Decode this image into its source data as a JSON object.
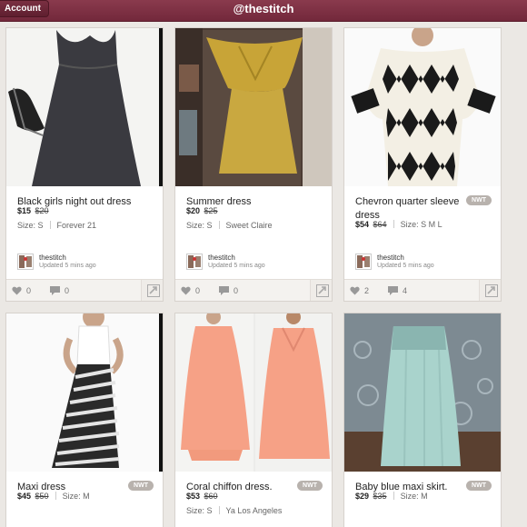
{
  "topbar": {
    "account_label": "Account",
    "title": "@thestitch"
  },
  "listings": [
    {
      "title": "Black girls night out dress",
      "price": "$15",
      "original_price": "$20",
      "size": "Size: S",
      "brand": "Forever 21",
      "nwt": "",
      "seller": "thestitch",
      "updated": "Updated 5 mins ago",
      "likes": "0",
      "comments": "0"
    },
    {
      "title": "Summer dress",
      "price": "$20",
      "original_price": "$25",
      "size": "Size: S",
      "brand": "Sweet Claire",
      "nwt": "",
      "seller": "thestitch",
      "updated": "Updated 5 mins ago",
      "likes": "0",
      "comments": "0"
    },
    {
      "title": "Chevron quarter sleeve dress",
      "price": "$54",
      "original_price": "$64",
      "size": "Size: S M L",
      "brand": "",
      "nwt": "NWT",
      "seller": "thestitch",
      "updated": "Updated 5 mins ago",
      "likes": "2",
      "comments": "4"
    },
    {
      "title": "Maxi dress",
      "price": "$45",
      "original_price": "$50",
      "size": "Size: M",
      "brand": "",
      "nwt": "NWT"
    },
    {
      "title": "Coral chiffon dress.",
      "price": "$53",
      "original_price": "$60",
      "size": "Size: S",
      "brand": "Ya Los Angeles",
      "nwt": "NWT"
    },
    {
      "title": "Baby blue maxi skirt.",
      "price": "$29",
      "original_price": "$35",
      "size": "Size: M",
      "brand": "",
      "nwt": "NWT"
    }
  ],
  "icons": {
    "like": "heart-icon",
    "comment": "comment-icon",
    "share": "share-icon"
  },
  "colors": {
    "topbar": "#7a2d40",
    "accent": "#8a3a4d",
    "nwt_badge": "#b8b2ad"
  }
}
